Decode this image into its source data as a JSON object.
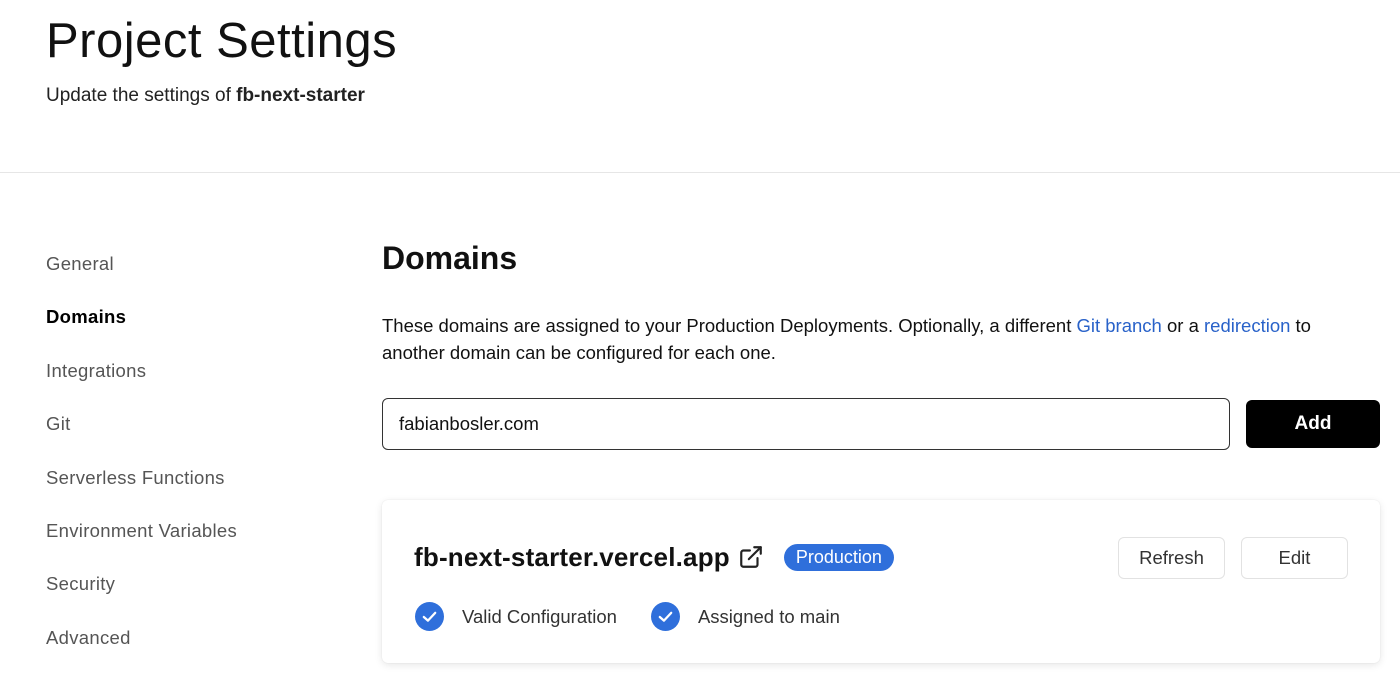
{
  "header": {
    "title": "Project Settings",
    "subtitle_prefix": "Update the settings of ",
    "project_name": "fb-next-starter"
  },
  "sidebar": {
    "items": [
      {
        "label": "General",
        "active": false
      },
      {
        "label": "Domains",
        "active": true
      },
      {
        "label": "Integrations",
        "active": false
      },
      {
        "label": "Git",
        "active": false
      },
      {
        "label": "Serverless Functions",
        "active": false
      },
      {
        "label": "Environment Variables",
        "active": false
      },
      {
        "label": "Security",
        "active": false
      },
      {
        "label": "Advanced",
        "active": false
      }
    ]
  },
  "domains": {
    "title": "Domains",
    "description_part1": "These domains are assigned to your Production Deployments. Optionally, a different ",
    "git_branch_link": "Git branch",
    "description_part2": " or a ",
    "redirection_link": "redirection",
    "description_part3": " to another domain can be configured for each one.",
    "input_value": "fabianbosler.com",
    "add_label": "Add"
  },
  "domain_card": {
    "domain": "fb-next-starter.vercel.app",
    "external_icon": "external-link-icon",
    "badge": "Production",
    "refresh_label": "Refresh",
    "edit_label": "Edit",
    "status": [
      {
        "label": "Valid Configuration",
        "icon": "check-circle-icon"
      },
      {
        "label": "Assigned to main",
        "icon": "check-circle-icon"
      }
    ]
  },
  "colors": {
    "accent_blue": "#2f6fdb",
    "link_blue": "#2962c9",
    "primary_button": "#000000"
  }
}
